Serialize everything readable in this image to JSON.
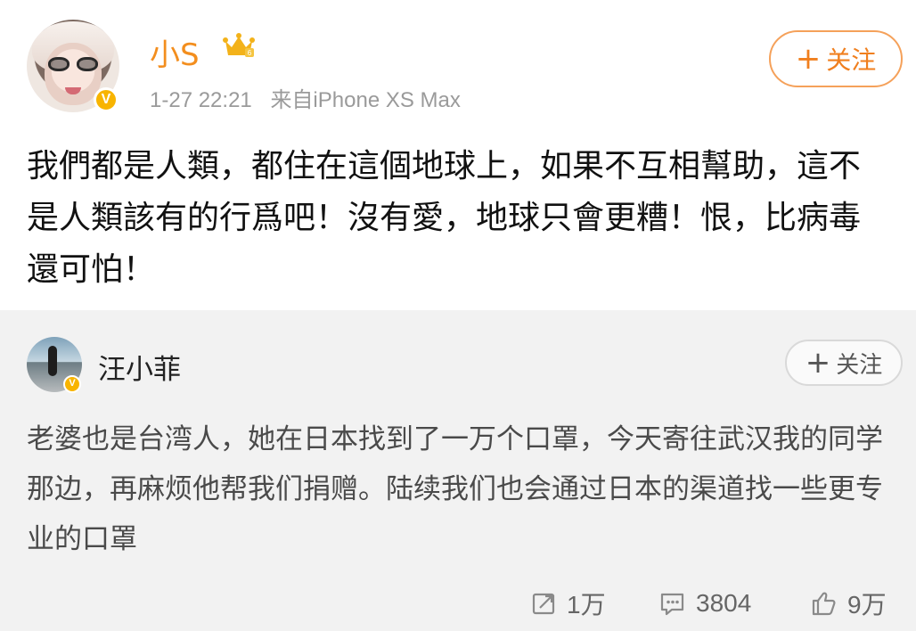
{
  "post": {
    "author_name": "小S",
    "timestamp": "1-27 22:21",
    "source": "来自iPhone XS Max",
    "follow_label": "关注",
    "text": "我們都是人類，都住在這個地球上，如果不互相幫助，這不是人類該有的行爲吧！沒有愛，地球只會更糟！恨，比病毒還可怕！"
  },
  "retweet": {
    "author_name": "汪小菲",
    "follow_label": "关注",
    "text": "老婆也是台湾人，她在日本找到了一万个口罩，今天寄往武汉我的同学那边，再麻烦他帮我们捐赠。陆续我们也会通过日本的渠道找一些更专业的口罩"
  },
  "actions": {
    "repost_count": "1万",
    "comment_count": "3804",
    "like_count": "9万"
  },
  "colors": {
    "accent_orange": "#f07f1e",
    "verified_badge": "#f8b400",
    "retweet_background": "#f2f2f2"
  },
  "icons": {
    "verified_badge_main": "verified-badge-icon",
    "vip_crown": "crown-vip-icon",
    "repost": "repost-icon",
    "comment": "comment-icon",
    "like": "thumbs-up-icon"
  }
}
